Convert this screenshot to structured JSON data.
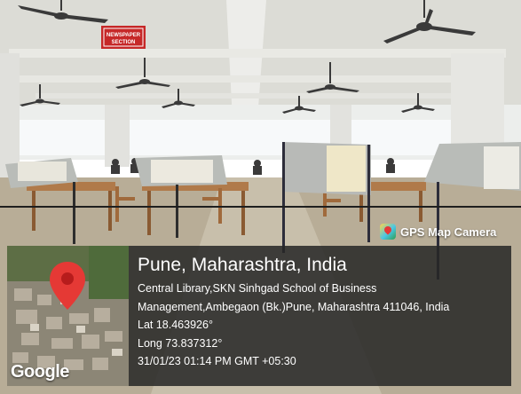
{
  "scene": {
    "description_sign": "NEWSPAPER SECTION",
    "colors": {
      "ceiling": "#dcdcd6",
      "floor": "#b8ad97",
      "wood": "#b07a4a",
      "board": "#b9bcb8",
      "sign": "#c62828"
    }
  },
  "overlay": {
    "app_name": "GPS Map Camera",
    "app_icon": "gps-map-camera-icon",
    "map_brand": "Google",
    "map_pin": "location-pin-icon",
    "place": "Pune, Maharashtra, India",
    "address_line1": "Central Library,SKN Sinhgad School of Business",
    "address_line2": "Management,Ambegaon (Bk.)Pune, Maharashtra 411046, India",
    "latitude": "Lat 18.463926°",
    "longitude": "Long 73.837312°",
    "timestamp": "31/01/23 01:14 PM GMT +05:30"
  }
}
